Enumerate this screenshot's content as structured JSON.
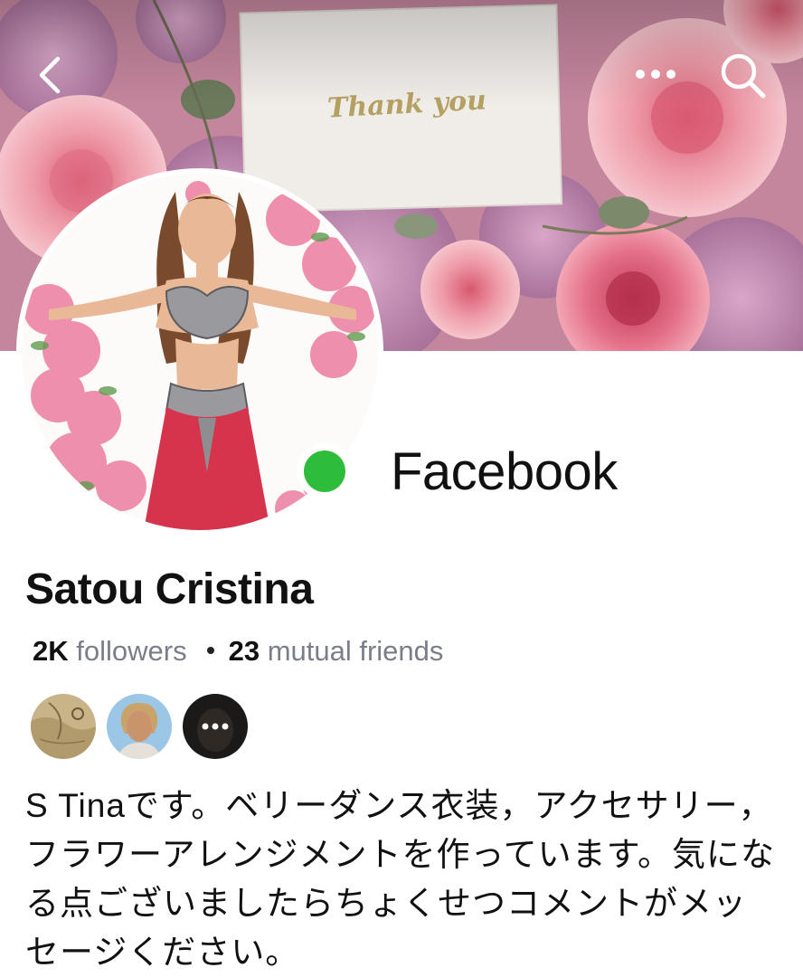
{
  "header": {
    "back_icon": "chevron-left-icon",
    "more_icon": "more-horizontal-icon",
    "search_icon": "search-icon"
  },
  "cover": {
    "card_text": "Thank you"
  },
  "profile": {
    "platform_label": "Facebook",
    "online_status_color": "#2ebd3a",
    "name": "Satou Cristina",
    "followers_count": "2K",
    "followers_label": "followers",
    "mutual_count": "23",
    "mutual_label": "mutual friends",
    "bio": "S Tinaです。ベリーダンス衣装，アクセサリー，フラワーアレンジメントを作っています。気になる点ございましたらちょくせつコメントがメッセージください。"
  },
  "mutual_friends": {
    "more_icon": "more-horizontal-icon"
  },
  "colors": {
    "accent_green": "#2ebd3a",
    "secondary_text": "#7a7f87"
  }
}
